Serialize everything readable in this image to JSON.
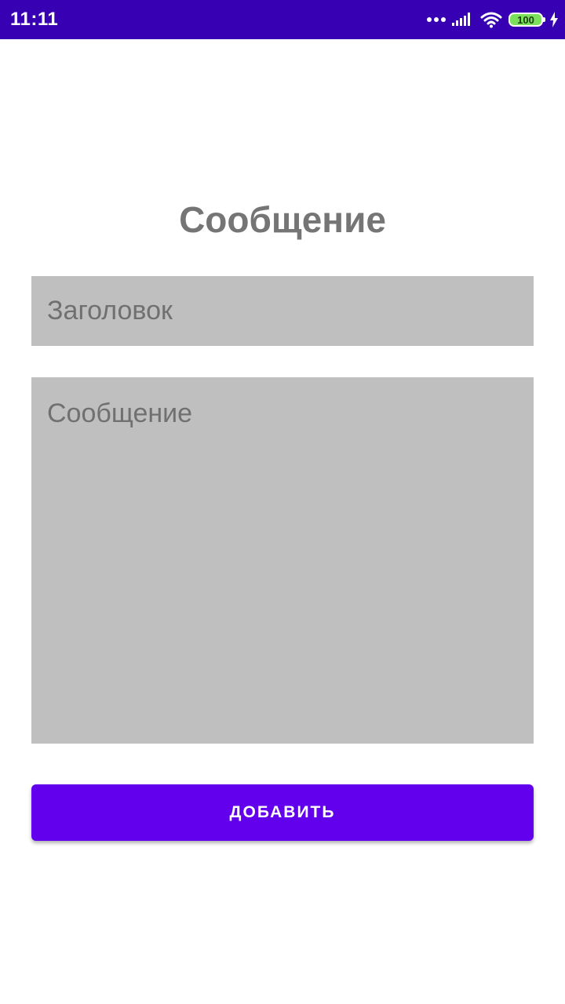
{
  "status_bar": {
    "time": "11:11",
    "battery_level": "100",
    "background_color": "#3700b3",
    "icons": [
      "more-dots-icon",
      "signal-icon",
      "wifi-icon",
      "battery-icon",
      "charging-icon"
    ]
  },
  "page": {
    "title": "Сообщение"
  },
  "form": {
    "title_placeholder": "Заголовок",
    "message_placeholder": "Сообщение",
    "field_color": "#bfbfbf"
  },
  "actions": {
    "add_label": "ДОБАВИТЬ",
    "button_color": "#6200ee"
  }
}
